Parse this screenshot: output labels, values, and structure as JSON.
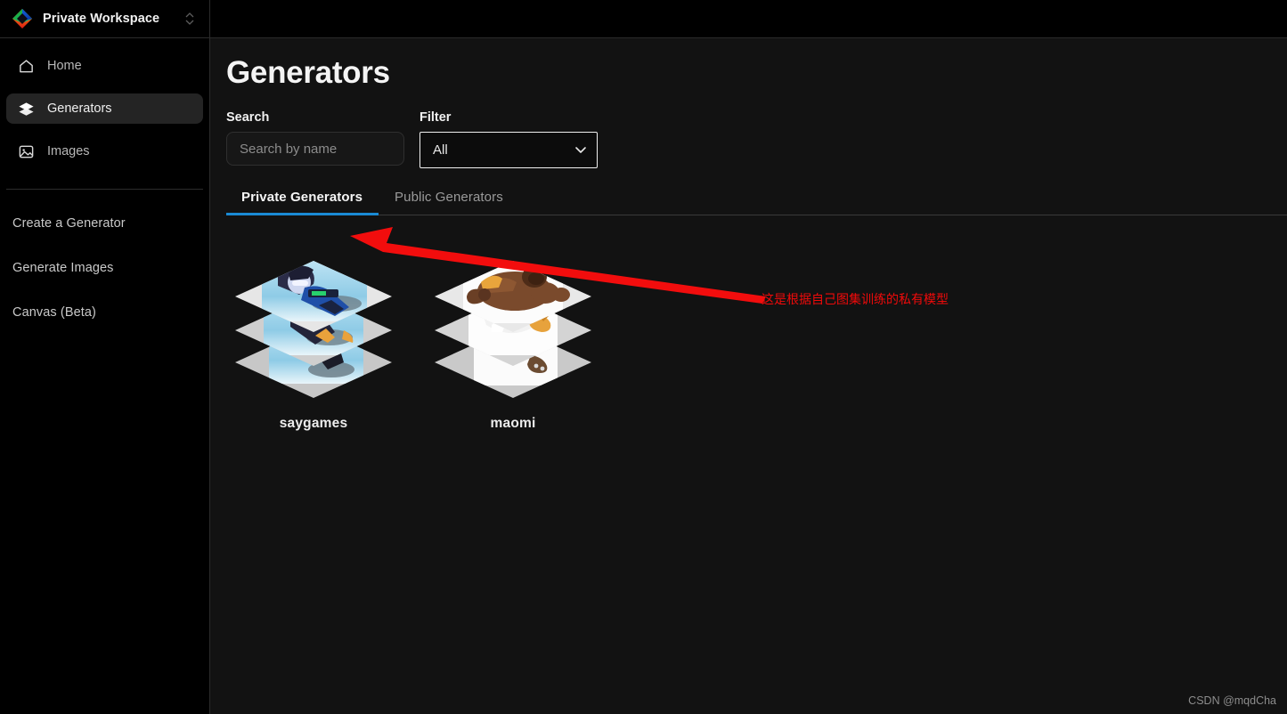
{
  "workspace": {
    "name": "Private Workspace",
    "logo_icon": "diamond-logo-icon",
    "switcher_icon": "chevron-up-down-icon"
  },
  "sidebar": {
    "nav_items": [
      {
        "label": "Home",
        "icon": "home-icon",
        "active": false
      },
      {
        "label": "Generators",
        "icon": "layers-icon",
        "active": true
      },
      {
        "label": "Images",
        "icon": "image-icon",
        "active": false
      }
    ],
    "links": [
      {
        "label": "Create a Generator"
      },
      {
        "label": "Generate Images"
      },
      {
        "label": "Canvas (Beta)"
      }
    ]
  },
  "main": {
    "page_title": "Generators",
    "search": {
      "label": "Search",
      "placeholder": "Search by name",
      "value": ""
    },
    "filter": {
      "label": "Filter",
      "selected": "All",
      "options": [
        "All"
      ],
      "chevron_icon": "chevron-down-icon"
    },
    "tabs": [
      {
        "label": "Private Generators",
        "active": true
      },
      {
        "label": "Public Generators",
        "active": false
      }
    ],
    "generators": [
      {
        "name": "saygames",
        "thumbnail": "layered-stack-game-character-thumbnail"
      },
      {
        "name": "maomi",
        "thumbnail": "layered-stack-bear-character-thumbnail"
      }
    ]
  },
  "annotations": {
    "arrow_icon": "red-arrow-pointing-left",
    "note_text": "这是根据自己图集训练的私有模型",
    "note_color": "#f00a0a"
  },
  "watermark": {
    "text": "CSDN @mqdCha"
  },
  "colors": {
    "accent_blue": "#1a8ad4",
    "sidebar_bg": "#000000",
    "main_bg": "#121212",
    "active_nav_bg": "#242424"
  }
}
